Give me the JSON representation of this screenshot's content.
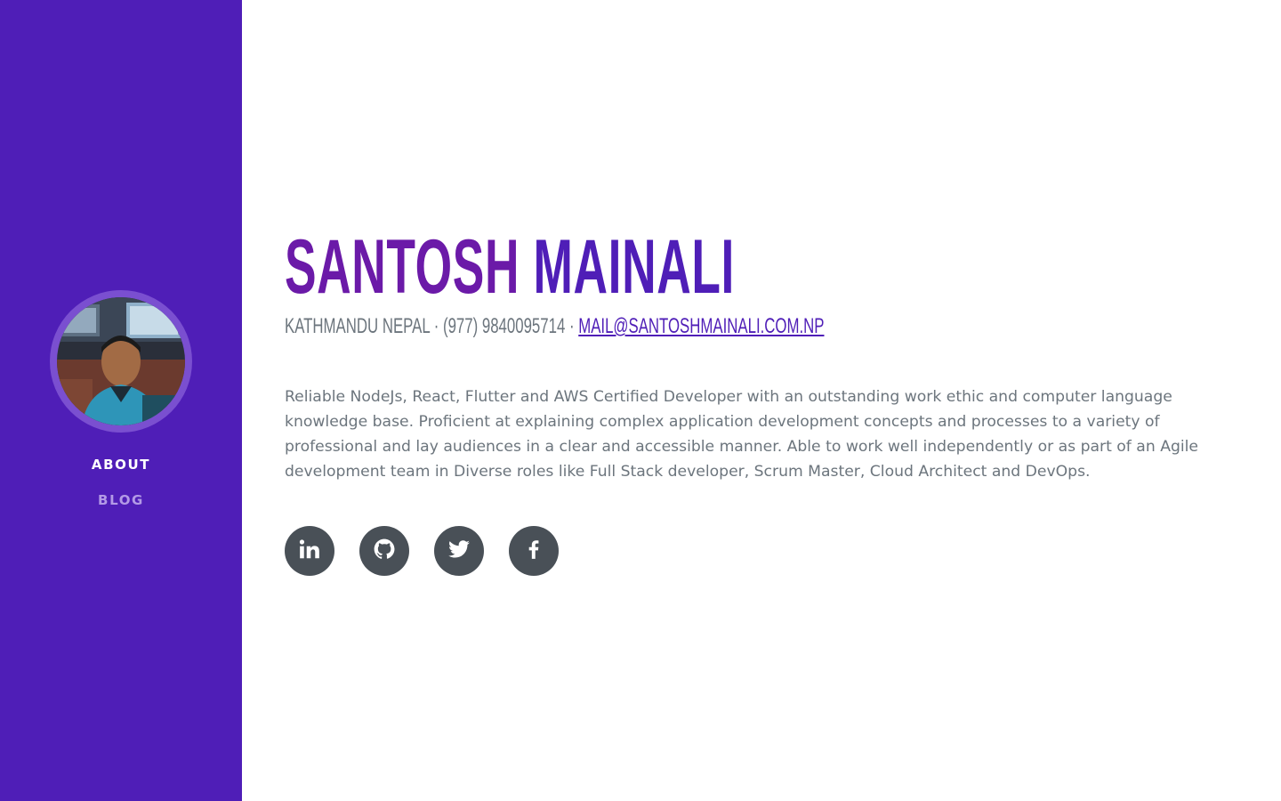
{
  "sidebar": {
    "avatar_alt": "profile photo",
    "nav": [
      {
        "label": "ABOUT",
        "active": true
      },
      {
        "label": "BLOG",
        "active": false
      }
    ]
  },
  "profile": {
    "first_name": "SANTOSH",
    "last_name": "MAINALI",
    "location_phone": "KATHMANDU NEPAL · (977) 9840095714 · ",
    "email": "MAIL@SANTOSHMAINALI.COM.NP",
    "bio": "Reliable NodeJs, React, Flutter and AWS Certified Developer with an outstanding work ethic and computer language knowledge base. Proficient at explaining complex application development concepts and processes to a variety of professional and lay audiences in a clear and accessible manner. Able to work well independently or as part of an Agile development team in Diverse roles like Full Stack developer, Scrum Master, Cloud Architect and DevOps."
  },
  "social": [
    {
      "icon": "linkedin-icon"
    },
    {
      "icon": "github-icon"
    },
    {
      "icon": "twitter-icon"
    },
    {
      "icon": "facebook-icon"
    }
  ],
  "colors": {
    "sidebar_bg": "#4f1eb7",
    "avatar_ring": "#7a4fd0",
    "name_first": "#6b1aa8",
    "name_last": "#4f1eb7",
    "text_muted": "#6c757d",
    "social_bg": "#495057"
  }
}
